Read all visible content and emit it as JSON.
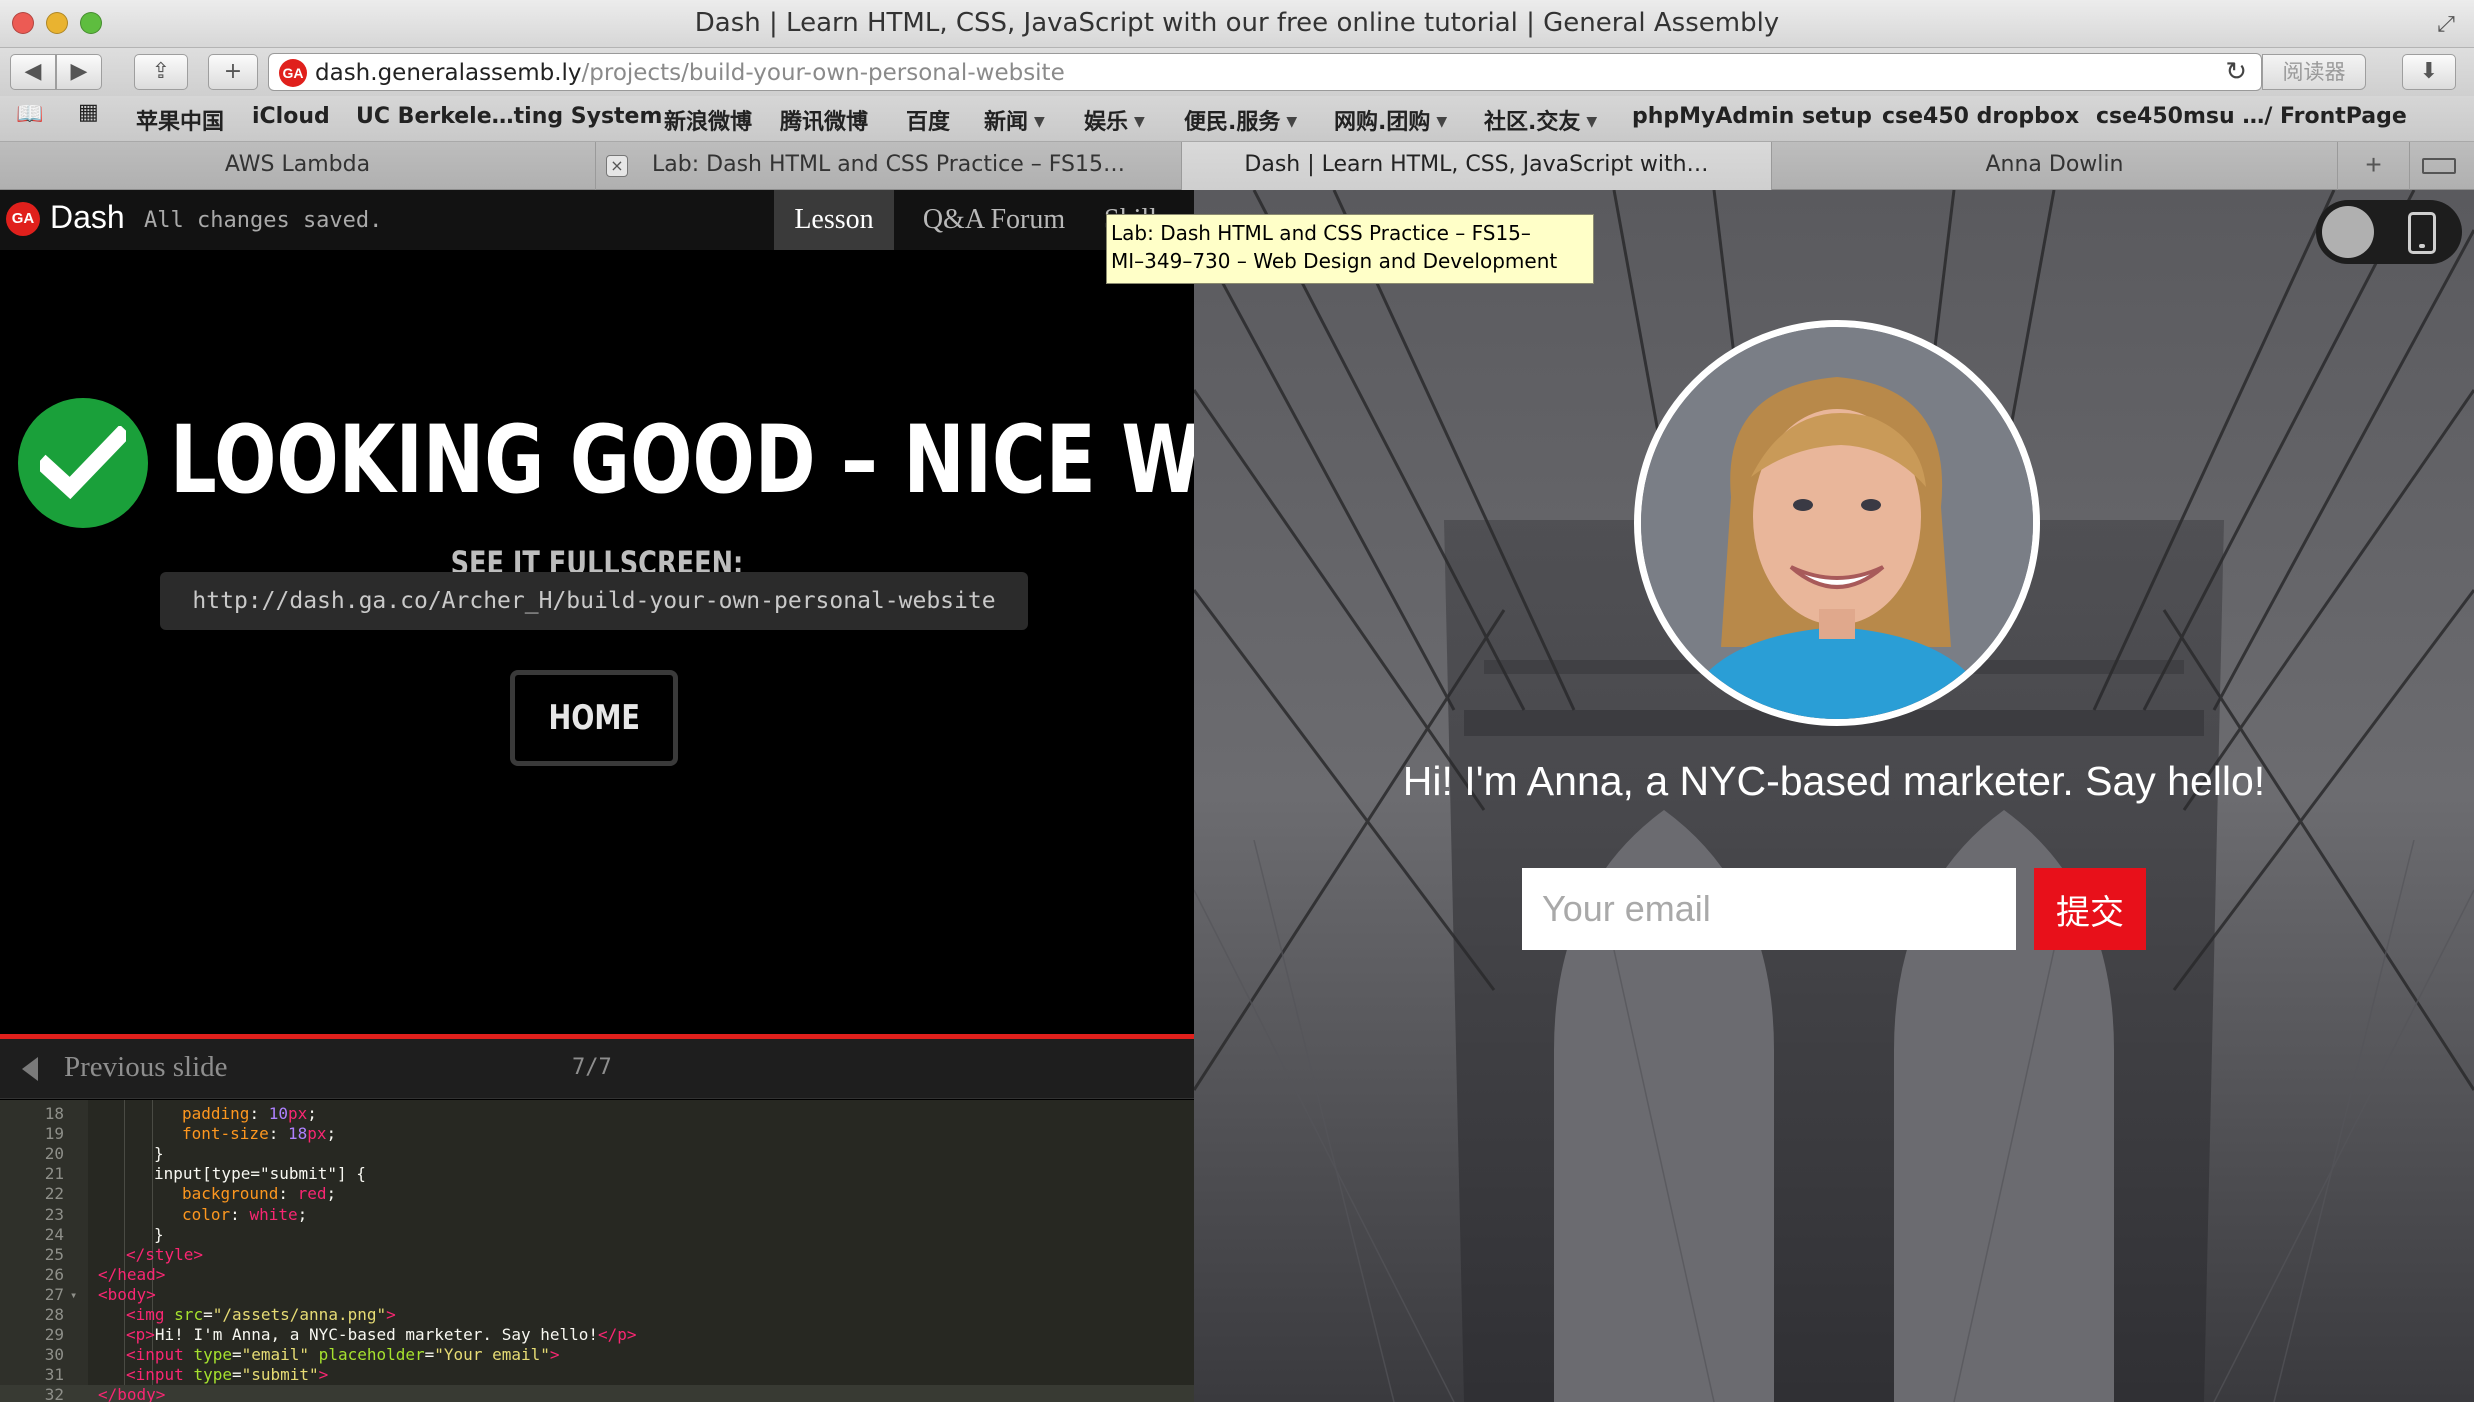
{
  "window": {
    "title": "Dash | Learn HTML, CSS, JavaScript with our free online tutorial | General Assembly"
  },
  "toolbar": {
    "back_icon": "back-arrow-icon",
    "forward_icon": "forward-arrow-icon",
    "url_host": "dash.generalassemb.ly",
    "url_path": "/projects/build-your-own-personal-website",
    "reader_label": "阅读器",
    "favicon_text": "GA"
  },
  "bookmarks": [
    {
      "label": "苹果中国",
      "menu": false
    },
    {
      "label": "iCloud",
      "menu": false
    },
    {
      "label": "UC Berkele…ting System",
      "menu": false
    },
    {
      "label": "新浪微博",
      "menu": false
    },
    {
      "label": "腾讯微博",
      "menu": false
    },
    {
      "label": "百度",
      "menu": false
    },
    {
      "label": "新闻",
      "menu": true
    },
    {
      "label": "娱乐",
      "menu": true
    },
    {
      "label": "便民.服务",
      "menu": true
    },
    {
      "label": "网购.团购",
      "menu": true
    },
    {
      "label": "社区.交友",
      "menu": true
    },
    {
      "label": "phpMyAdmin setup",
      "menu": false
    },
    {
      "label": "cse450 dropbox",
      "menu": false
    },
    {
      "label": "cse450msu …/ FrontPage",
      "menu": false
    }
  ],
  "tabs": [
    {
      "label": "AWS Lambda",
      "active": false
    },
    {
      "label": "Lab: Dash HTML and CSS Practice – FS15…",
      "active": false
    },
    {
      "label": "Dash | Learn HTML, CSS, JavaScript with…",
      "active": true
    },
    {
      "label": "Anna Dowlin",
      "active": false
    }
  ],
  "tooltip": {
    "line1": "Lab: Dash HTML and CSS Practice – FS15–",
    "line2": "MI–349–730 – Web Design and Development"
  },
  "app": {
    "logo_text": "GA",
    "brand": "Dash",
    "save_status": "All changes saved.",
    "nav": {
      "lesson": "Lesson",
      "qa": "Q&A Forum",
      "skills": "Skills"
    }
  },
  "success": {
    "headline": "LOOKING GOOD – NICE WORK!",
    "fullscreen_label": "SEE IT FULLSCREEN:",
    "share_url": "http://dash.ga.co/Archer_H/build-your-own-personal-website",
    "home_label": "HOME"
  },
  "slide_nav": {
    "prev_label": "Previous slide",
    "count": "7/7"
  },
  "code": {
    "lines": [
      {
        "n": "18",
        "fold": "",
        "indent": 3,
        "tokens": [
          [
            "prop",
            "padding"
          ],
          [
            "plain",
            ": "
          ],
          [
            "num",
            "10"
          ],
          [
            "tag",
            "px"
          ],
          [
            "plain",
            ";"
          ]
        ]
      },
      {
        "n": "19",
        "fold": "",
        "indent": 3,
        "tokens": [
          [
            "prop",
            "font-size"
          ],
          [
            "plain",
            ": "
          ],
          [
            "num",
            "18"
          ],
          [
            "tag",
            "px"
          ],
          [
            "plain",
            ";"
          ]
        ]
      },
      {
        "n": "20",
        "fold": "",
        "indent": 2,
        "tokens": [
          [
            "plain",
            "}"
          ]
        ]
      },
      {
        "n": "21",
        "fold": "",
        "indent": 2,
        "tokens": [
          [
            "plain",
            "input[type=\"submit\"] {"
          ]
        ]
      },
      {
        "n": "22",
        "fold": "",
        "indent": 3,
        "tokens": [
          [
            "prop",
            "background"
          ],
          [
            "plain",
            ": "
          ],
          [
            "tag",
            "red"
          ],
          [
            "plain",
            ";"
          ]
        ]
      },
      {
        "n": "23",
        "fold": "",
        "indent": 3,
        "tokens": [
          [
            "prop",
            "color"
          ],
          [
            "plain",
            ": "
          ],
          [
            "tag",
            "white"
          ],
          [
            "plain",
            ";"
          ]
        ]
      },
      {
        "n": "24",
        "fold": "",
        "indent": 2,
        "tokens": [
          [
            "plain",
            "}"
          ]
        ]
      },
      {
        "n": "25",
        "fold": "",
        "indent": 1,
        "tokens": [
          [
            "tag",
            "</style>"
          ]
        ]
      },
      {
        "n": "26",
        "fold": "",
        "indent": 0,
        "tokens": [
          [
            "tag",
            "</head>"
          ]
        ]
      },
      {
        "n": "27",
        "fold": "▾",
        "indent": 0,
        "tokens": [
          [
            "tag",
            "<body>"
          ]
        ]
      },
      {
        "n": "28",
        "fold": "",
        "indent": 1,
        "tokens": [
          [
            "tag",
            "<img "
          ],
          [
            "attr",
            "src"
          ],
          [
            "plain",
            "="
          ],
          [
            "str",
            "\"/assets/anna.png\""
          ],
          [
            "tag",
            ">"
          ]
        ]
      },
      {
        "n": "29",
        "fold": "",
        "indent": 1,
        "tokens": [
          [
            "tag",
            "<p>"
          ],
          [
            "plain",
            "Hi! I'm Anna, a NYC-based marketer. Say hello!"
          ],
          [
            "tag",
            "</p>"
          ]
        ]
      },
      {
        "n": "30",
        "fold": "",
        "indent": 1,
        "tokens": [
          [
            "tag",
            "<input "
          ],
          [
            "attr",
            "type"
          ],
          [
            "plain",
            "="
          ],
          [
            "str",
            "\"email\""
          ],
          [
            "attr",
            " placeholder"
          ],
          [
            "plain",
            "="
          ],
          [
            "str",
            "\"Your email\""
          ],
          [
            "tag",
            ">"
          ]
        ]
      },
      {
        "n": "31",
        "fold": "",
        "indent": 1,
        "tokens": [
          [
            "tag",
            "<input "
          ],
          [
            "attr",
            "type"
          ],
          [
            "plain",
            "="
          ],
          [
            "str",
            "\"submit\""
          ],
          [
            "tag",
            ">"
          ]
        ]
      },
      {
        "n": "32",
        "fold": "",
        "indent": 0,
        "tokens": [
          [
            "tag",
            "</body>"
          ]
        ],
        "active": true
      }
    ]
  },
  "preview": {
    "hello": "Hi! I'm Anna, a NYC-based marketer. Say hello!",
    "email_placeholder": "Your email",
    "submit_label": "提交"
  },
  "colors": {
    "ga_red": "#e0201c",
    "check_green": "#1aa03a",
    "submit_red": "#e8101a",
    "tooltip_bg": "#ffffc8"
  }
}
